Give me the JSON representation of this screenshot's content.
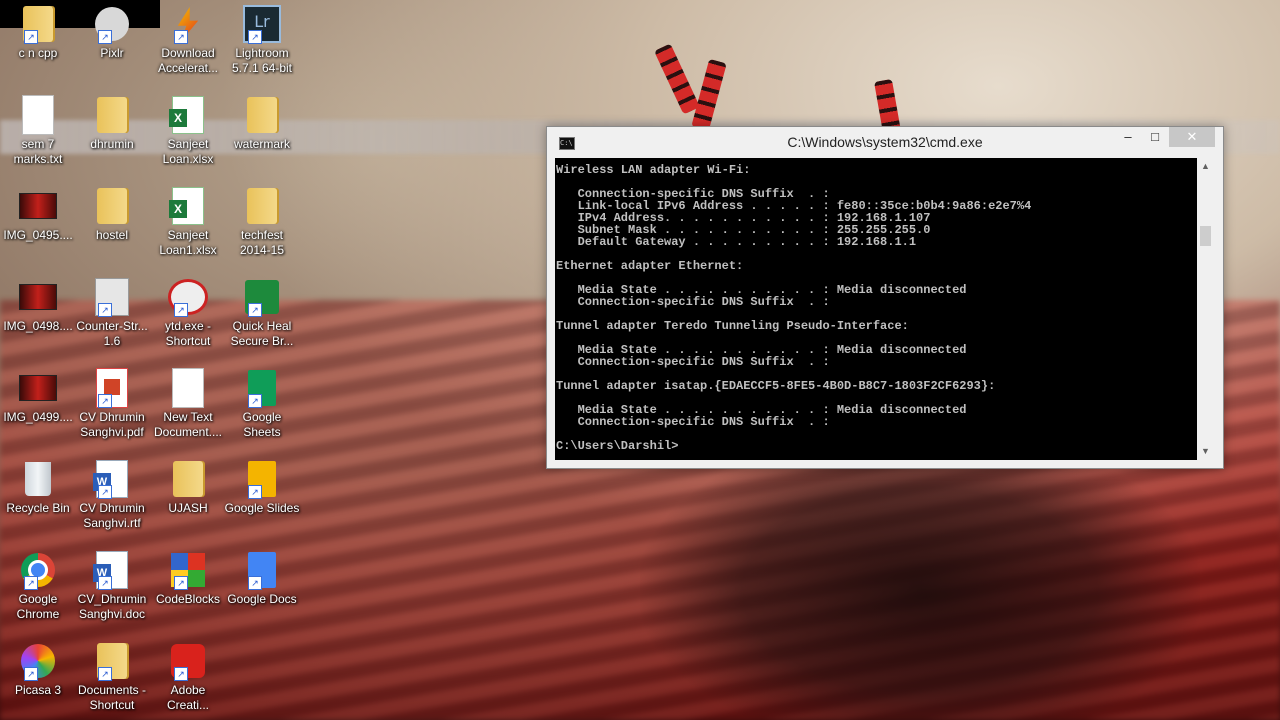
{
  "desktop": {
    "icons": [
      {
        "label": "c n cpp",
        "icon": "folder-shortcut-icon"
      },
      {
        "label": "Pixlr",
        "icon": "pixlr-icon"
      },
      {
        "label": "Download Accelerat...",
        "icon": "download-accelerator-icon"
      },
      {
        "label": "Lightroom 5.7.1 64-bit",
        "icon": "lightroom-icon"
      },
      {
        "label": "sem 7 marks.txt",
        "icon": "text-file-icon"
      },
      {
        "label": "dhrumin",
        "icon": "folder-icon"
      },
      {
        "label": "Sanjeet Loan.xlsx",
        "icon": "excel-icon"
      },
      {
        "label": "watermark",
        "icon": "folder-icon"
      },
      {
        "label": "IMG_0495....",
        "icon": "image-icon"
      },
      {
        "label": "hostel",
        "icon": "folder-icon"
      },
      {
        "label": "Sanjeet Loan1.xlsx",
        "icon": "excel-icon"
      },
      {
        "label": "techfest 2014-15",
        "icon": "folder-icon"
      },
      {
        "label": "IMG_0498....",
        "icon": "image-icon"
      },
      {
        "label": "Counter-Str... 1.6",
        "icon": "counter-strike-icon"
      },
      {
        "label": "ytd.exe - Shortcut",
        "icon": "ytd-icon"
      },
      {
        "label": "Quick Heal Secure Br...",
        "icon": "quick-heal-icon"
      },
      {
        "label": "IMG_0499....",
        "icon": "image-icon"
      },
      {
        "label": "CV Dhrumin Sanghvi.pdf",
        "icon": "pdf-icon"
      },
      {
        "label": "New Text Document....",
        "icon": "text-file-icon"
      },
      {
        "label": "Google Sheets",
        "icon": "google-sheets-icon"
      },
      {
        "label": "Recycle Bin",
        "icon": "recycle-bin-icon"
      },
      {
        "label": "CV Dhrumin Sanghvi.rtf",
        "icon": "word-icon"
      },
      {
        "label": "UJASH",
        "icon": "folder-icon"
      },
      {
        "label": "Google Slides",
        "icon": "google-slides-icon"
      },
      {
        "label": "Google Chrome",
        "icon": "chrome-icon"
      },
      {
        "label": "CV_Dhrumin Sanghvi.doc",
        "icon": "word-icon"
      },
      {
        "label": "CodeBlocks",
        "icon": "codeblocks-icon"
      },
      {
        "label": "Google Docs",
        "icon": "google-docs-icon"
      },
      {
        "label": "Picasa 3",
        "icon": "picasa-icon"
      },
      {
        "label": "Documents - Shortcut",
        "icon": "folder-shortcut-icon"
      },
      {
        "label": "Adobe Creati...",
        "icon": "adobe-cc-icon"
      }
    ]
  },
  "cmd": {
    "title": "C:\\Windows\\system32\\cmd.exe",
    "min_glyph": "–",
    "max_glyph": "□",
    "close_glyph": "✕",
    "output": "Wireless LAN adapter Wi-Fi:\n\n   Connection-specific DNS Suffix  . :\n   Link-local IPv6 Address . . . . . : fe80::35ce:b0b4:9a86:e2e7%4\n   IPv4 Address. . . . . . . . . . . : 192.168.1.107\n   Subnet Mask . . . . . . . . . . . : 255.255.255.0\n   Default Gateway . . . . . . . . . : 192.168.1.1\n\nEthernet adapter Ethernet:\n\n   Media State . . . . . . . . . . . : Media disconnected\n   Connection-specific DNS Suffix  . :\n\nTunnel adapter Teredo Tunneling Pseudo-Interface:\n\n   Media State . . . . . . . . . . . : Media disconnected\n   Connection-specific DNS Suffix  . :\n\nTunnel adapter isatap.{EDAECCF5-8FE5-4B0D-B8C7-1803F2CF6293}:\n\n   Media State . . . . . . . . . . . : Media disconnected\n   Connection-specific DNS Suffix  . :\n\nC:\\Users\\Darshil>"
  }
}
